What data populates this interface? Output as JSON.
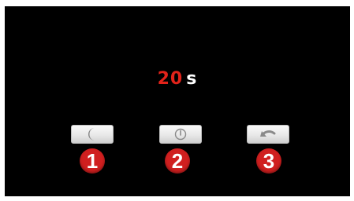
{
  "countdown": {
    "value": "20",
    "unit": "s"
  },
  "buttons": [
    {
      "icon": "moon-icon",
      "label": "Sleep"
    },
    {
      "icon": "power-icon",
      "label": "Power"
    },
    {
      "icon": "back-arrow-icon",
      "label": "Back"
    }
  ],
  "badges": [
    "1",
    "2",
    "3"
  ],
  "colors": {
    "background": "#000000",
    "countdown_number": "#e2231a",
    "badge": "#d01f1f"
  }
}
